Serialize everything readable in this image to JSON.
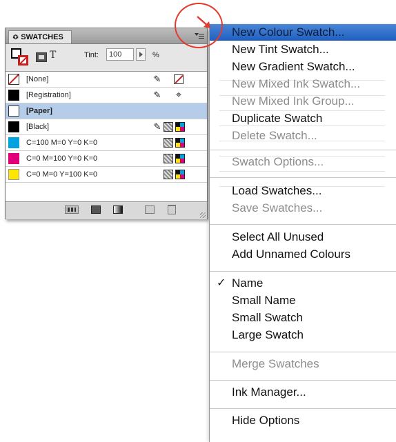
{
  "panel": {
    "tab_label": "≎ SWATCHES",
    "tint_label": "Tint:",
    "tint_value": "100",
    "tint_unit": "%",
    "text_toggle": "T",
    "swatches": [
      {
        "label": "[None]",
        "color": "none",
        "selected": false
      },
      {
        "label": "[Registration]",
        "color": "#000000",
        "selected": false
      },
      {
        "label": "[Paper]",
        "color": "#ffffff",
        "selected": true
      },
      {
        "label": "[Black]",
        "color": "#000000",
        "selected": false
      },
      {
        "label": "C=100 M=0 Y=0 K=0",
        "color": "#00a3e0",
        "selected": false
      },
      {
        "label": "C=0 M=100 Y=0 K=0",
        "color": "#e2007a",
        "selected": false
      },
      {
        "label": "C=0 M=0 Y=100 K=0",
        "color": "#ffe600",
        "selected": false
      }
    ]
  },
  "menu": {
    "items": [
      {
        "label": "New Colour Swatch...",
        "state": "highlight"
      },
      {
        "label": "New Tint Swatch...",
        "state": "enabled"
      },
      {
        "label": "New Gradient Swatch...",
        "state": "enabled"
      },
      {
        "label": "New Mixed Ink Swatch...",
        "state": "disabled"
      },
      {
        "label": "New Mixed Ink Group...",
        "state": "disabled"
      },
      {
        "label": "Duplicate Swatch",
        "state": "enabled"
      },
      {
        "label": "Delete Swatch...",
        "state": "disabled"
      },
      {
        "label": "Swatch Options...",
        "state": "disabled"
      },
      {
        "label": "Load Swatches...",
        "state": "enabled"
      },
      {
        "label": "Save Swatches...",
        "state": "disabled"
      },
      {
        "label": "Select All Unused",
        "state": "enabled"
      },
      {
        "label": "Add Unnamed Colours",
        "state": "enabled"
      },
      {
        "label": "Name",
        "state": "checked"
      },
      {
        "label": "Small Name",
        "state": "enabled"
      },
      {
        "label": "Small Swatch",
        "state": "enabled"
      },
      {
        "label": "Large Swatch",
        "state": "enabled"
      },
      {
        "label": "Merge Swatches",
        "state": "disabled"
      },
      {
        "label": "Ink Manager...",
        "state": "enabled"
      },
      {
        "label": "Hide Options",
        "state": "enabled"
      }
    ],
    "check_glyph": "✓"
  },
  "colors": {
    "highlight": "#2f6fd0",
    "selected_row": "#b5cde9",
    "annotation": "#e23b30"
  }
}
